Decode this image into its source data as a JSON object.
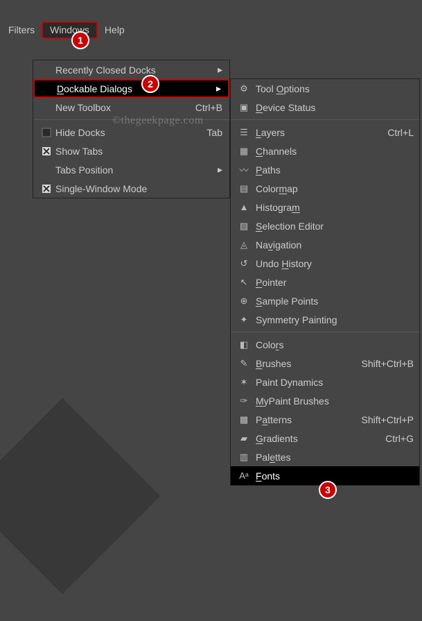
{
  "menubar": {
    "filters": "Filters",
    "windows": "Windows",
    "help": "Help"
  },
  "watermark": "©thegeekpage.com",
  "badges": {
    "b1": "1",
    "b2": "2",
    "b3": "3"
  },
  "menu1": {
    "recent": "Recently Closed Docks",
    "dockable": "Dockable Dialogs",
    "newtoolbox": "New Toolbox",
    "newtoolbox_accel": "Ctrl+B",
    "hidedocks": "Hide Docks",
    "hidedocks_accel": "Tab",
    "showtabs": "Show Tabs",
    "tabsposition": "Tabs Position",
    "singlewindow": "Single-Window Mode"
  },
  "menu2": {
    "tooloptions": "Tool Options",
    "devicestatus": "Device Status",
    "layers": "Layers",
    "layers_accel": "Ctrl+L",
    "channels": "Channels",
    "paths": "Paths",
    "colormap": "Colormap",
    "histogram": "Histogram",
    "selectioneditor": "Selection Editor",
    "navigation": "Navigation",
    "undohistory": "Undo History",
    "pointer": "Pointer",
    "samplepoints": "Sample Points",
    "symmetrypainting": "Symmetry Painting",
    "colors": "Colors",
    "brushes": "Brushes",
    "brushes_accel": "Shift+Ctrl+B",
    "paintdynamics": "Paint Dynamics",
    "mypaintbrushes": "MyPaint Brushes",
    "patterns": "Patterns",
    "patterns_accel": "Shift+Ctrl+P",
    "gradients": "Gradients",
    "gradients_accel": "Ctrl+G",
    "palettes": "Palettes",
    "fonts": "Fonts"
  }
}
